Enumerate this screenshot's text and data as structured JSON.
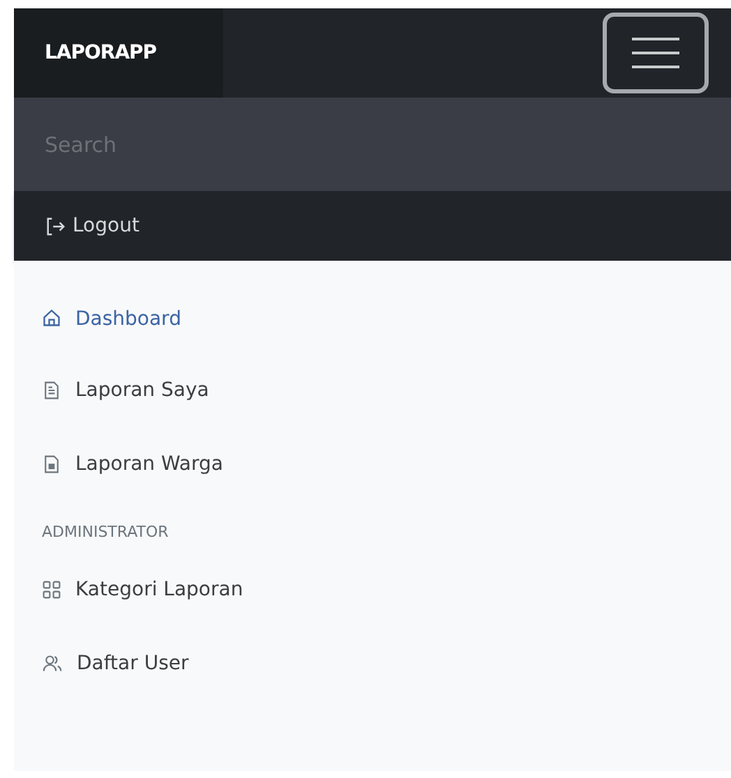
{
  "navbar": {
    "brand": "LAPORAPP",
    "search": {
      "placeholder": "Search"
    },
    "logout": "Logout"
  },
  "sidebar": {
    "items": [
      {
        "label": "Dashboard",
        "selected": true
      },
      {
        "label": "Laporan Saya",
        "selected": false
      },
      {
        "label": "Laporan Warga",
        "selected": false
      }
    ],
    "admin_heading": "ADMINISTRATOR",
    "admin_items": [
      {
        "label": "Kategori Laporan",
        "selected": false
      },
      {
        "label": "Daftar User",
        "selected": false
      }
    ]
  }
}
